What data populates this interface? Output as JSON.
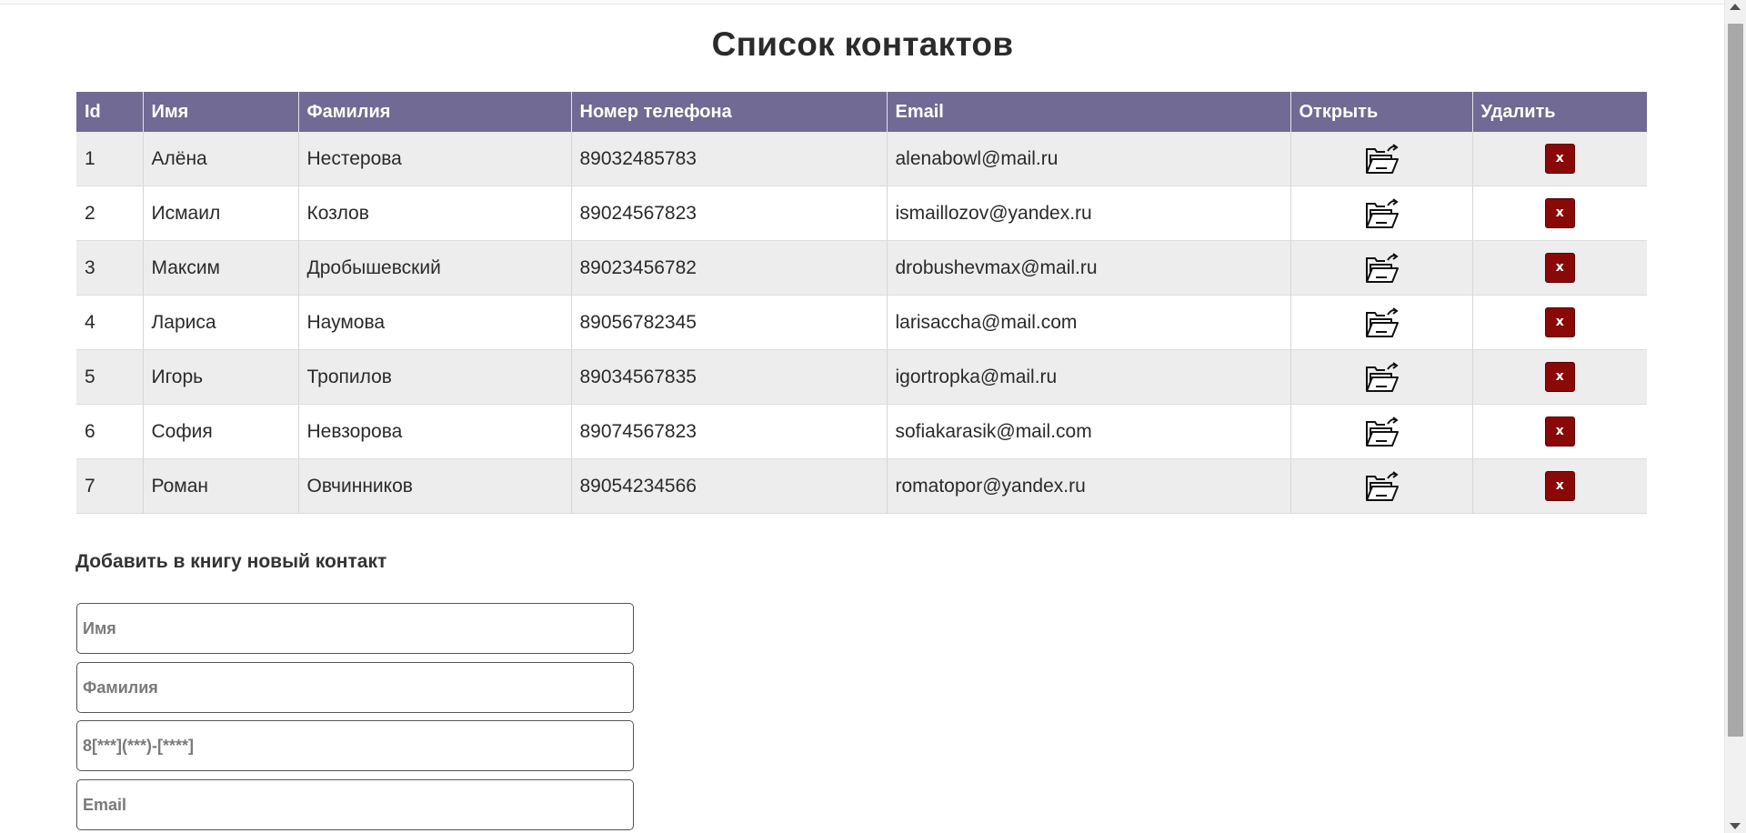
{
  "page": {
    "title": "Список контактов"
  },
  "table": {
    "headers": {
      "id": "Id",
      "first_name": "Имя",
      "last_name": "Фамилия",
      "phone": "Номер телефона",
      "email": "Email",
      "open": "Открыть",
      "delete": "Удалить"
    },
    "rows": [
      {
        "id": "1",
        "first_name": "Алёна",
        "last_name": "Нестерова",
        "phone": "89032485783",
        "email": "alenabowl@mail.ru"
      },
      {
        "id": "2",
        "first_name": "Исмаил",
        "last_name": "Козлов",
        "phone": "89024567823",
        "email": "ismaillozov@yandex.ru"
      },
      {
        "id": "3",
        "first_name": "Максим",
        "last_name": "Дробышевский",
        "phone": "89023456782",
        "email": "drobushevmax@mail.ru"
      },
      {
        "id": "4",
        "first_name": "Лариса",
        "last_name": "Наумова",
        "phone": "89056782345",
        "email": "larisaccha@mail.com"
      },
      {
        "id": "5",
        "first_name": "Игорь",
        "last_name": "Тропилов",
        "phone": "89034567835",
        "email": "igortropka@mail.ru"
      },
      {
        "id": "6",
        "first_name": "София",
        "last_name": "Невзорова",
        "phone": "89074567823",
        "email": "sofiakarasik@mail.com"
      },
      {
        "id": "7",
        "first_name": "Роман",
        "last_name": "Овчинников",
        "phone": "89054234566",
        "email": "romatopor@yandex.ru"
      }
    ],
    "open_icon": "open-folder-icon",
    "delete_label": "x"
  },
  "form": {
    "heading": "Добавить в книгу новый контакт",
    "first_name_placeholder": "Имя",
    "last_name_placeholder": "Фамилия",
    "phone_placeholder": "8[***](***)-[****]",
    "email_placeholder": "Email"
  },
  "colors": {
    "header_bg": "#706a95",
    "delete_button": "#8a0808",
    "row_stripe": "#ededed"
  }
}
